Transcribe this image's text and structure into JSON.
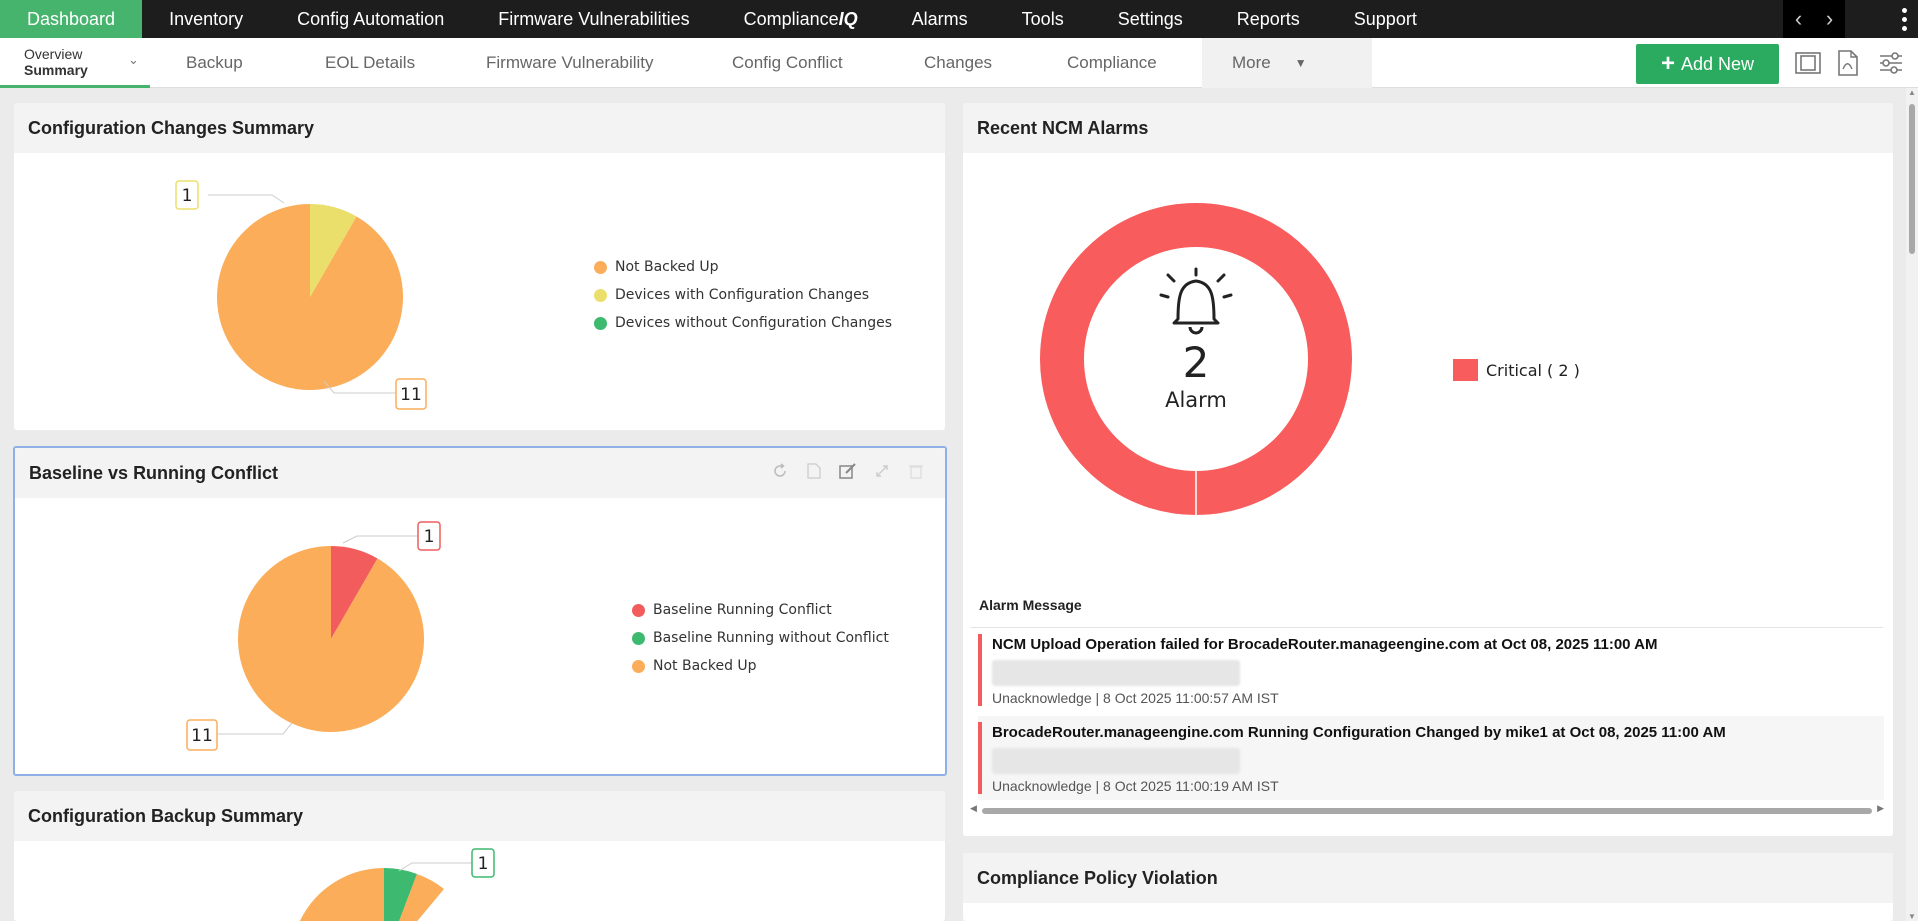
{
  "topnav": {
    "items": [
      {
        "label": "Dashboard",
        "active": true
      },
      {
        "label": "Inventory"
      },
      {
        "label": "Config Automation"
      },
      {
        "label": "Firmware Vulnerabilities"
      },
      {
        "label_main": "Compliance",
        "label_suffix": "IQ"
      },
      {
        "label": "Alarms"
      },
      {
        "label": "Tools"
      },
      {
        "label": "Settings"
      },
      {
        "label": "Reports"
      },
      {
        "label": "Support"
      }
    ]
  },
  "subnav": {
    "overview_line1": "Overview",
    "overview_line2": "Summary",
    "items": [
      "Backup",
      "EOL Details",
      "Firmware Vulnerability",
      "Config Conflict",
      "Changes",
      "Compliance"
    ],
    "more_label": "More",
    "add_new_label": "Add New"
  },
  "widgets": {
    "config_changes": {
      "title": "Configuration Changes Summary",
      "chart_data": {
        "type": "pie",
        "categories": [
          "Not Backed Up",
          "Devices with Configuration Changes",
          "Devices without Configuration Changes"
        ],
        "values": [
          11,
          1,
          0
        ],
        "colors": [
          "#fbad5a",
          "#ebdf6b",
          "#3dba6f"
        ],
        "data_labels": [
          "11",
          "1"
        ]
      }
    },
    "baseline_conflict": {
      "title": "Baseline vs Running Conflict",
      "chart_data": {
        "type": "pie",
        "categories": [
          "Baseline Running Conflict",
          "Baseline Running without Conflict",
          "Not Backed Up"
        ],
        "values": [
          1,
          0,
          11
        ],
        "colors": [
          "#f25c5c",
          "#3dba6f",
          "#fbad5a"
        ],
        "data_labels": [
          "1",
          "11"
        ]
      }
    },
    "backup_summary": {
      "title": "Configuration Backup Summary",
      "data_label": "1"
    },
    "ncm_alarms": {
      "title": "Recent NCM Alarms",
      "count": "2",
      "count_label": "Alarm",
      "legend_label": "Critical ( 2 )",
      "ring_color": "#f85c5c",
      "chart_data": {
        "type": "pie",
        "categories": [
          "Critical ( 2 )"
        ],
        "values": [
          2
        ],
        "colors": [
          "#f85c5c"
        ]
      },
      "table_header": "Alarm Message",
      "rows": [
        {
          "message": "NCM Upload Operation failed for BrocadeRouter.manageengine.com at Oct 08, 2025 11:00 AM",
          "meta": "Unacknowledge | 8 Oct 2025 11:00:57 AM IST"
        },
        {
          "message": "BrocadeRouter.manageengine.com Running Configuration Changed by mike1 at Oct 08, 2025 11:00 AM",
          "meta": "Unacknowledge | 8 Oct 2025 11:00:19 AM IST"
        }
      ]
    },
    "compliance_violation": {
      "title": "Compliance Policy Violation"
    }
  }
}
